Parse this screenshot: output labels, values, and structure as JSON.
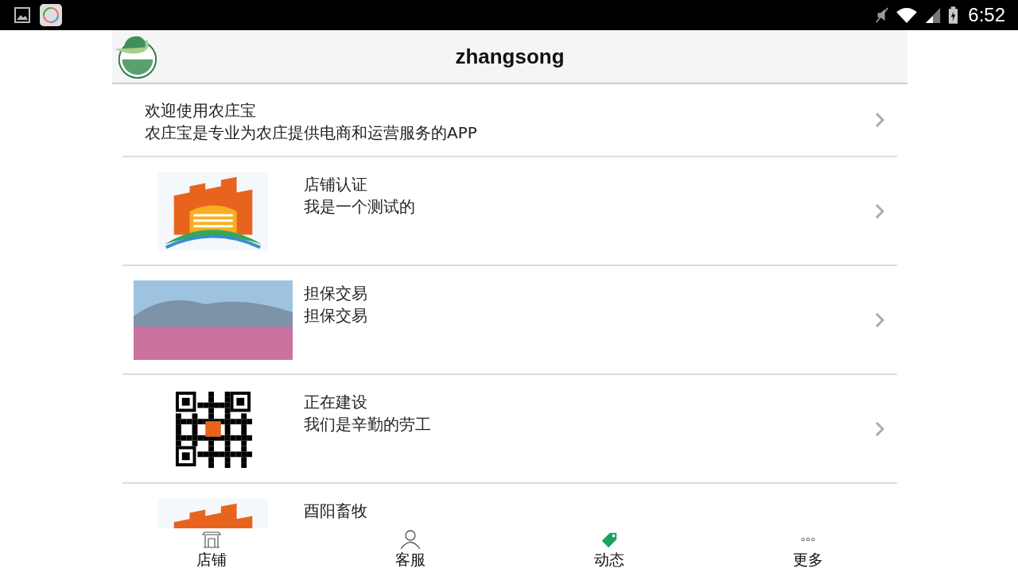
{
  "status_bar": {
    "time": "6:52"
  },
  "header": {
    "title": "zhangsong"
  },
  "items": [
    {
      "kind": "text",
      "title": "欢迎使用农庄宝",
      "subtitle": "农庄宝是专业为农庄提供电商和运营服务的APP"
    },
    {
      "kind": "emblem",
      "title": "店铺认证",
      "subtitle": "我是一个测试的"
    },
    {
      "kind": "photo",
      "title": "担保交易",
      "subtitle": "担保交易"
    },
    {
      "kind": "qr",
      "title": "正在建设",
      "subtitle": "我们是辛勤的劳工"
    },
    {
      "kind": "emblem",
      "title": "酉阳畜牧"
    }
  ],
  "tabs": [
    {
      "kind": "shop",
      "label": "店铺",
      "selected": false
    },
    {
      "kind": "person",
      "label": "客服",
      "selected": false
    },
    {
      "kind": "tag",
      "label": "动态",
      "selected": true
    },
    {
      "kind": "more",
      "label": "更多",
      "selected": false
    }
  ]
}
